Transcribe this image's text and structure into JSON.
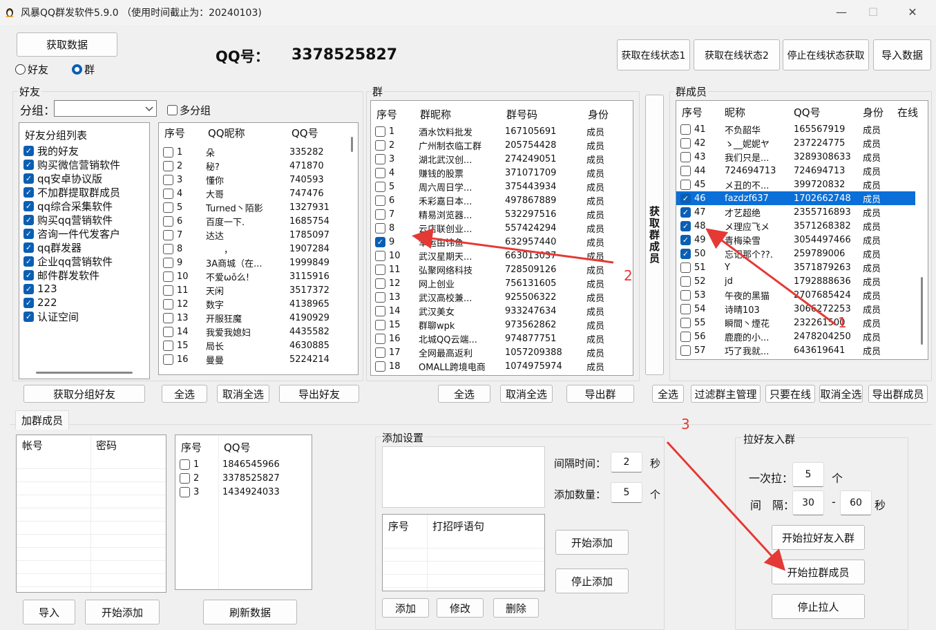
{
  "window": {
    "title": "风暴QQ群发软件5.9.0 （使用时间截止为：20240103)",
    "min": "—",
    "max": "☐",
    "close": "✕"
  },
  "top": {
    "fetch_data": "获取数据",
    "radio_friend": "好友",
    "radio_group": "群",
    "qq_label": "QQ号：",
    "qq_value": "3378525827",
    "online1": "获取在线状态1",
    "online2": "获取在线状态2",
    "stop_online": "停止在线状态获取",
    "import": "导入数据"
  },
  "friends": {
    "label": "好友",
    "group_label": "分组：",
    "multi": "多分组",
    "tree_header": "好友分组列表",
    "tree": [
      "我的好友",
      "购买微信营销软件",
      "qq安卓协议版",
      "不加群提取群成员",
      "qq综合采集软件",
      "购买qq营销软件",
      "咨询一件代发客户",
      "qq群发器",
      "企业qq营销软件",
      "邮件群发软件",
      "123",
      "222",
      "认证空间"
    ],
    "cols": [
      "序号",
      "QQ昵称",
      "QQ号"
    ],
    "rows": [
      [
        "1",
        "朵",
        "335282"
      ],
      [
        "2",
        "秘?",
        "471870"
      ],
      [
        "3",
        "懂你",
        "740593"
      ],
      [
        "4",
        "大哥",
        "747476"
      ],
      [
        "5",
        "Turned丶陌影",
        "1327931"
      ],
      [
        "6",
        "百度一下.",
        "1685754"
      ],
      [
        "7",
        "达达",
        "1785097"
      ],
      [
        "8",
        "　　，",
        "1907284"
      ],
      [
        "9",
        "3A商城（在...",
        "1999849"
      ],
      [
        "10",
        "不爱ωǒ么!",
        "3115916"
      ],
      [
        "11",
        "天闲",
        "3517372"
      ],
      [
        "12",
        "数字",
        "4138965"
      ],
      [
        "13",
        "开服狂魔",
        "4190929"
      ],
      [
        "14",
        "我爱我媳妇",
        "4435582"
      ],
      [
        "15",
        "局长",
        "4630885"
      ],
      [
        "16",
        "曼曼",
        "5224214"
      ]
    ],
    "btn_fetch": "获取分组好友",
    "btn_all": "全选",
    "btn_none": "取消全选",
    "btn_export": "导出好友"
  },
  "groups": {
    "label": "群",
    "cols": [
      "序号",
      "群昵称",
      "群号码",
      "身份"
    ],
    "rows": [
      [
        "1",
        "酒水饮料批发",
        "167105691",
        "成员"
      ],
      [
        "2",
        "广州制衣临工群",
        "205754428",
        "成员"
      ],
      [
        "3",
        "湖北武汉创...",
        "274249051",
        "成员"
      ],
      [
        "4",
        "赚钱的股票",
        "371071709",
        "成员"
      ],
      [
        "5",
        "周六周日学...",
        "375443934",
        "成员"
      ],
      [
        "6",
        "禾彩嘉日本...",
        "497867889",
        "成员"
      ],
      [
        "7",
        "精易浏览器...",
        "532297516",
        "成员"
      ],
      [
        "8",
        "云店联创业...",
        "557424294",
        "成员"
      ],
      [
        "9",
        "幸运由讳鱼",
        "632957440",
        "成员"
      ],
      [
        "10",
        "武汉星期天...",
        "663013037",
        "成员"
      ],
      [
        "11",
        "弘聚网络科技",
        "728509126",
        "成员"
      ],
      [
        "12",
        "网上创业",
        "756131605",
        "成员"
      ],
      [
        "13",
        "武汉高校兼...",
        "925506322",
        "成员"
      ],
      [
        "14",
        "武汉美女",
        "933247634",
        "成员"
      ],
      [
        "15",
        "群聊wpk",
        "973562862",
        "成员"
      ],
      [
        "16",
        "北城QQ云端...",
        "974877751",
        "成员"
      ],
      [
        "17",
        "全网最高返利",
        "1057209388",
        "成员"
      ],
      [
        "18",
        "OMALL跨境电商",
        "1074975974",
        "成员"
      ]
    ],
    "btn_all": "全选",
    "btn_none": "取消全选",
    "btn_export": "导出群",
    "btn_members": "获取群成员"
  },
  "members": {
    "label": "群成员",
    "cols": [
      "序号",
      "昵称",
      "QQ号",
      "身份",
      "在线"
    ],
    "rows": [
      [
        "41",
        "不负韶华",
        "165567919",
        "成员"
      ],
      [
        "42",
        "ゝ__妮妮ヤ",
        "237224775",
        "成员"
      ],
      [
        "43",
        "我们只是...",
        "3289308633",
        "成员"
      ],
      [
        "44",
        "724694713",
        "724694713",
        "成员"
      ],
      [
        "45",
        "メ丑的不...",
        "399720832",
        "成员"
      ],
      [
        "46",
        "fazdzf637",
        "1702662748",
        "成员"
      ],
      [
        "47",
        "才艺超绝",
        "2355716893",
        "成员"
      ],
      [
        "48",
        "メ理应飞メ",
        "3571268382",
        "成员"
      ],
      [
        "49",
        "青梅染雪",
        "3054497466",
        "成员"
      ],
      [
        "50",
        "忘记那个??.",
        "259789006",
        "成员"
      ],
      [
        "51",
        "Y",
        "3571879263",
        "成员"
      ],
      [
        "52",
        "jd",
        "1792888636",
        "成员"
      ],
      [
        "53",
        "午夜的黑猫",
        "2707685424",
        "成员"
      ],
      [
        "54",
        "诗晴103",
        "3066272253",
        "成员"
      ],
      [
        "55",
        "瞬間丶煙花",
        "232261500",
        "成员"
      ],
      [
        "56",
        "鹿鹿的小...",
        "2478204250",
        "成员"
      ],
      [
        "57",
        "巧了我就...",
        "643619641",
        "成员"
      ]
    ],
    "btn_all": "全选",
    "btn_filter": "过滤群主管理",
    "btn_online": "只要在线",
    "btn_none": "取消全选",
    "btn_export": "导出群成员"
  },
  "add": {
    "tab": "加群成员",
    "acc_cols": [
      "帐号",
      "密码"
    ],
    "qq_cols": [
      "序号",
      "QQ号"
    ],
    "qq_rows": [
      [
        "1",
        "1846545966"
      ],
      [
        "2",
        "3378525827"
      ],
      [
        "3",
        "1434924033"
      ]
    ],
    "btn_import": "导入",
    "btn_start": "开始添加",
    "btn_refresh": "刷新数据"
  },
  "settings": {
    "label": "添加设置",
    "interval_label": "间隔时间：",
    "interval": "2",
    "interval_unit": "秒",
    "count_label": "添加数量：",
    "count": "5",
    "count_unit": "个",
    "greet_cols": [
      "序号",
      "打招呼语句"
    ],
    "btn_start": "开始添加",
    "btn_stop": "停止添加",
    "btn_add": "添加",
    "btn_edit": "修改",
    "btn_del": "删除"
  },
  "pull": {
    "label": "拉好友入群",
    "once_label": "一次拉：",
    "once": "5",
    "once_unit": "个",
    "interval_label": "间　隔：",
    "from": "30",
    "dash": "-",
    "to": "60",
    "sec": "秒",
    "btn_pull_friends": "开始拉好友入群",
    "btn_pull_members": "开始拉群成员",
    "btn_stop": "停止拉人"
  },
  "annotations": {
    "n1": "1",
    "n2": "2",
    "n3": "3",
    "color": "#e53935"
  }
}
